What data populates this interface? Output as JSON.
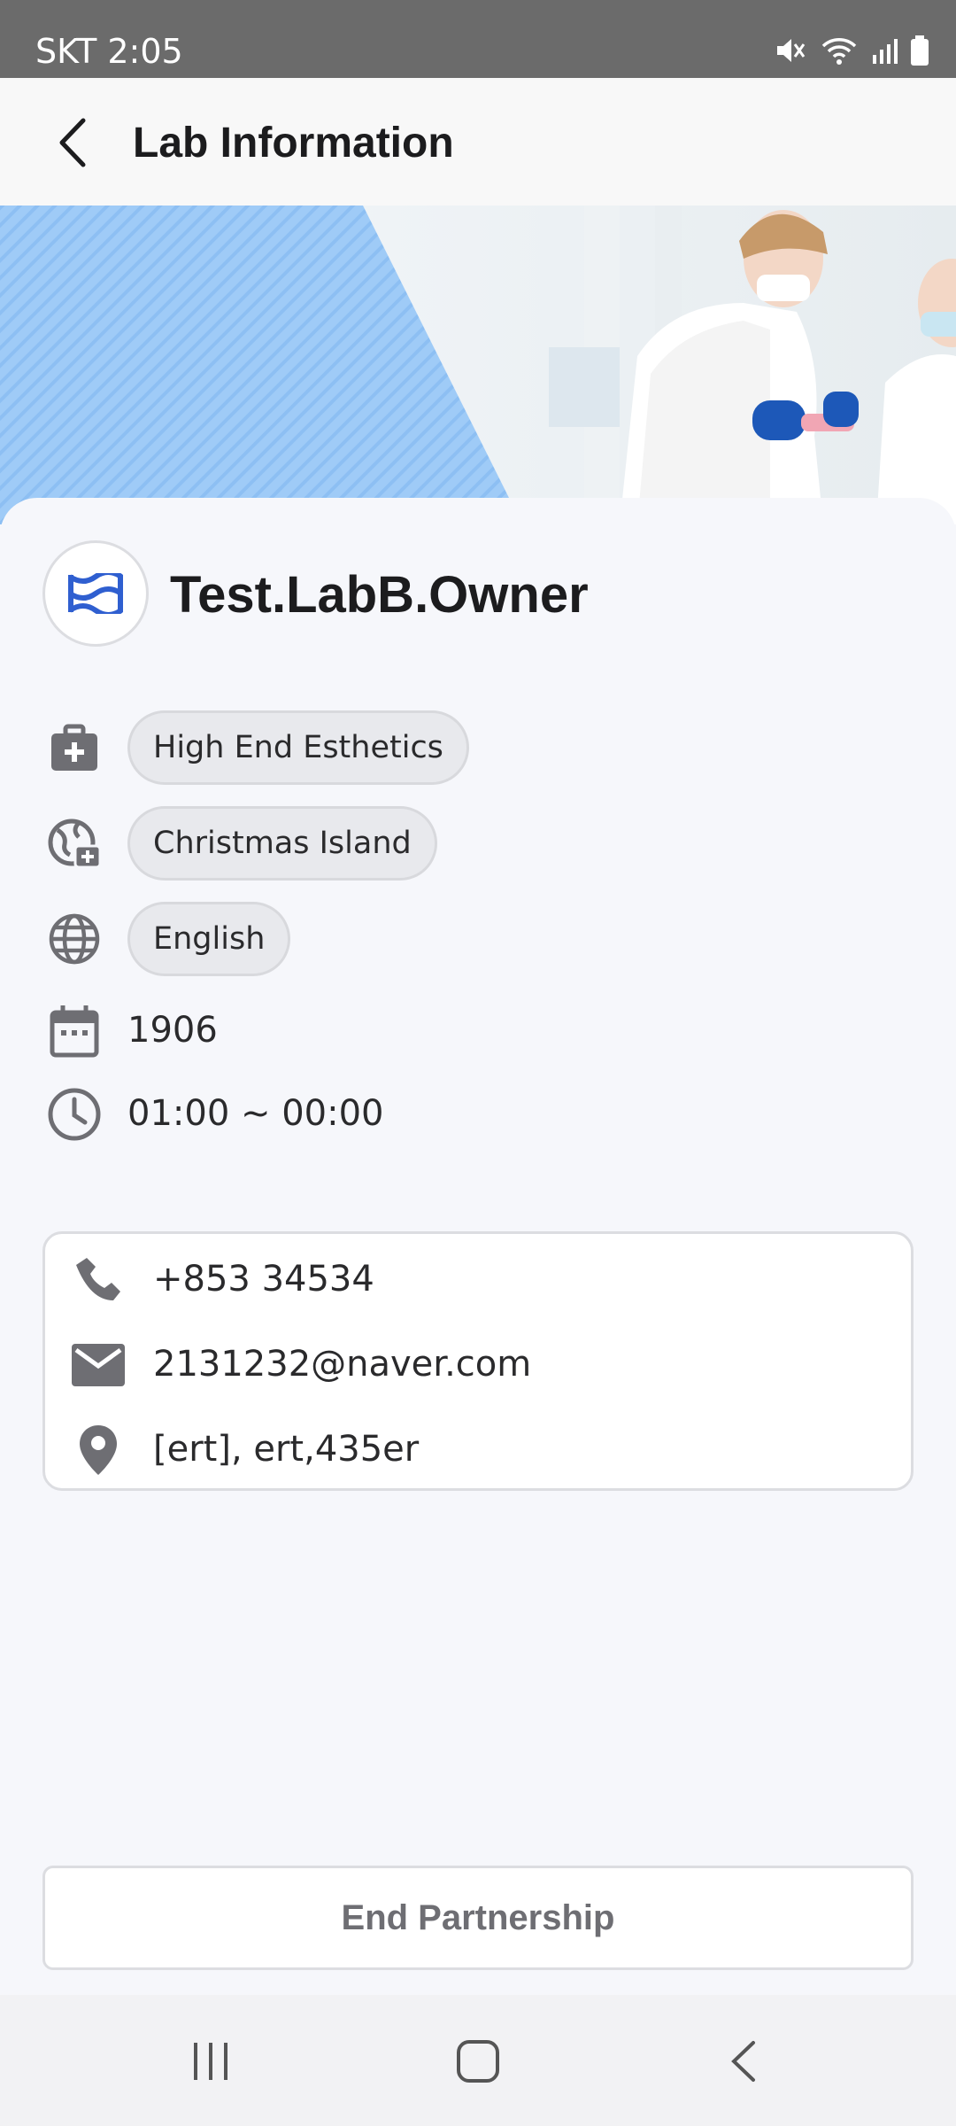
{
  "status_bar": {
    "carrier_time": "SKT 2:05",
    "icons": [
      "mute-icon",
      "wifi-icon",
      "signal-icon",
      "battery-icon"
    ]
  },
  "app_bar": {
    "title": "Lab Information",
    "back_icon": "chevron-left-icon"
  },
  "lab": {
    "name": "Test.LabB.Owner",
    "logo_icon": "lab-logo-icon",
    "specialty": "High End Esthetics",
    "region": "Christmas Island",
    "language": "English",
    "established_year": "1906",
    "hours": "01:00 ~ 00:00"
  },
  "contact": {
    "phone": "+853 34534",
    "email": "2131232@naver.com",
    "address": "[ert], ert,435er"
  },
  "actions": {
    "end_partnership": "End Partnership"
  },
  "colors": {
    "accent_blue": "#2f5fd0",
    "banner_blue": "#9fcbf7",
    "icon_gray": "#6e6e73"
  }
}
